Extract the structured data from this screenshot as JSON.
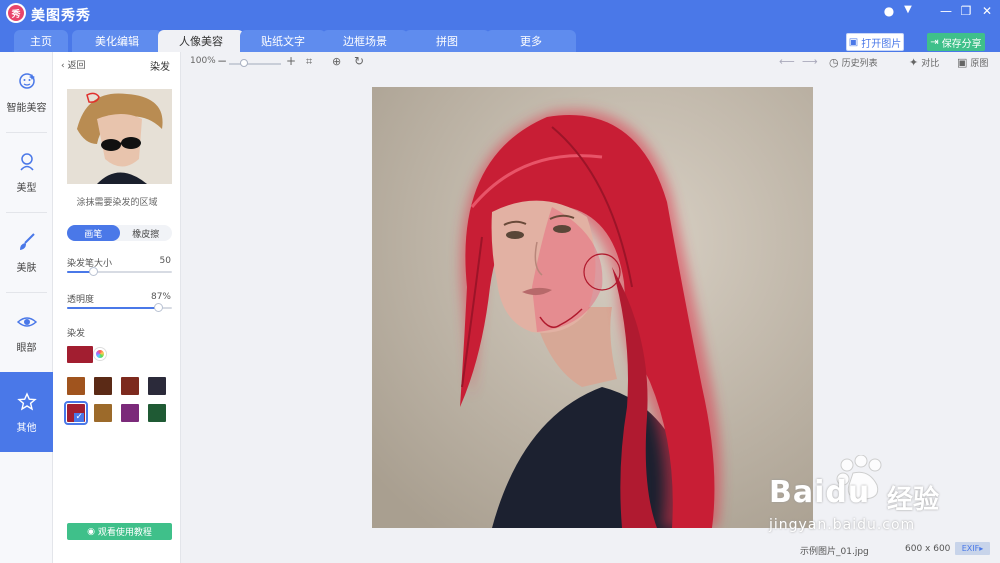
{
  "app": {
    "logo_text": "秀",
    "title": "美图秀秀"
  },
  "tabs": [
    {
      "label": "主页"
    },
    {
      "label": "美化编辑"
    },
    {
      "label": "人像美容"
    },
    {
      "label": "贴纸文字"
    },
    {
      "label": "边框场景"
    },
    {
      "label": "拼图"
    },
    {
      "label": "更多"
    }
  ],
  "active_tab": "人像美容",
  "header_buttons": {
    "open": "打开图片",
    "save": "保存分享"
  },
  "sidenav": [
    {
      "label": "智能美容",
      "icon": "smart-beauty-icon"
    },
    {
      "label": "美型",
      "icon": "body-shape-icon"
    },
    {
      "label": "美肤",
      "icon": "skin-brush-icon"
    },
    {
      "label": "眼部",
      "icon": "eye-icon"
    },
    {
      "label": "其他",
      "icon": "star-icon"
    }
  ],
  "sidenav_active": "其他",
  "panel": {
    "back": "返回",
    "title": "染发",
    "hint": "涂抹需要染发的区域",
    "mode_brush": "画笔",
    "mode_eraser": "橡皮擦",
    "brush_size_label": "染发笔大小",
    "brush_size_value": "50",
    "brush_size_level": 0.25,
    "opacity_label": "透明度",
    "opacity_value": "87%",
    "opacity_level": 0.87,
    "color_label": "染发",
    "current_color": "#a21e30",
    "swatches": [
      "#a0541e",
      "#5b2a16",
      "#7d2a1e",
      "#2b2a3a",
      "#a21e30",
      "#9c6a2a",
      "#7b2a7a",
      "#1f5a34"
    ],
    "selected_swatch": 4,
    "tutorial": "观看使用教程"
  },
  "toolbar": {
    "zoom": "100%",
    "zoom_level": 0.25,
    "history": "历史列表",
    "compare": "对比",
    "original": "原图"
  },
  "status": {
    "filename": "示例图片_01.jpg",
    "size": "600 x 600",
    "exif": "EXIF"
  },
  "watermark": {
    "brand": "Baidu",
    "brand_cn": "经验",
    "url": "jingyan.baidu.com"
  },
  "colors": {
    "accent": "#4a78e8",
    "green": "#3fc08a",
    "hair_red": "#c81e35"
  }
}
